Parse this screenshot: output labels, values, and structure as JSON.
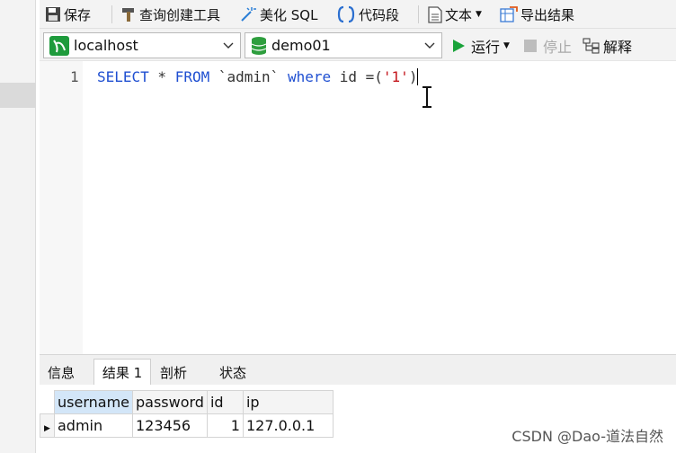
{
  "toolbar": {
    "save": "保存",
    "query_builder": "查询创建工具",
    "beautify": "美化 SQL",
    "snippet": "代码段",
    "text": "文本",
    "export": "导出结果"
  },
  "connection": {
    "server": "localhost",
    "database": "demo01",
    "run": "运行",
    "stop": "停止",
    "explain": "解释"
  },
  "editor": {
    "line_number": "1",
    "tokens": {
      "select": "SELECT",
      "star": " * ",
      "from": "FROM",
      "table": " `admin` ",
      "where": "where",
      "col": " id =(",
      "value": "'1'",
      "close": ")"
    }
  },
  "result_tabs": [
    "信息",
    "结果 1",
    "剖析",
    "状态"
  ],
  "result": {
    "columns": [
      "username",
      "password",
      "id",
      "ip"
    ],
    "rows": [
      [
        "admin",
        "123456",
        "1",
        "127.0.0.1"
      ]
    ]
  },
  "watermark": "CSDN @Dao-道法自然",
  "colors": {
    "keyword": "#1f4fd1",
    "string": "#c4161c",
    "run_green": "#1aa33a",
    "db_green": "#2e9e3e"
  }
}
